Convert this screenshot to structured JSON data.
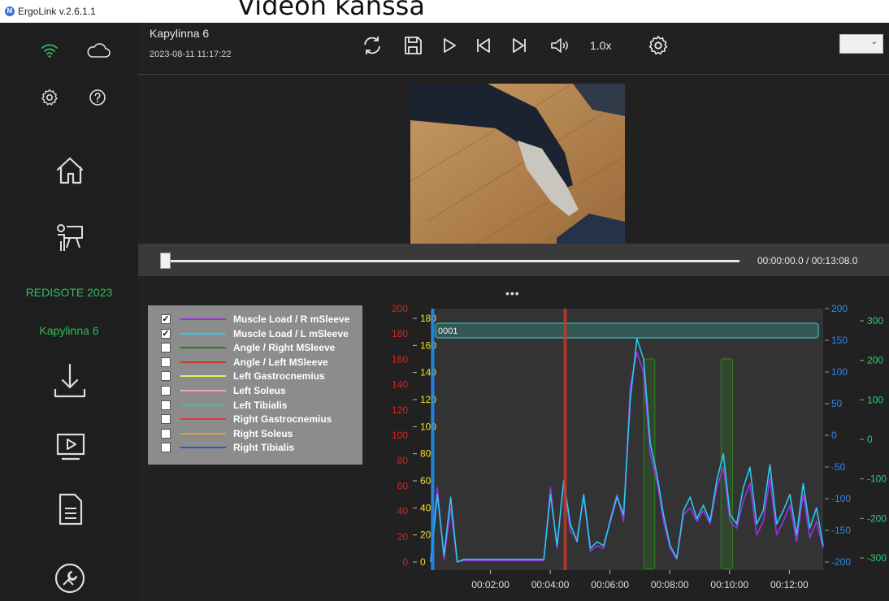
{
  "app": {
    "name": "ErgoLink v.2.6.1.1",
    "logo_letter": "M"
  },
  "overlay_title": "Videon kanssa",
  "sidebar": {
    "icons": [
      "wifi-icon",
      "cloud-icon",
      "gear-icon",
      "help-icon",
      "home-icon",
      "presentation-icon",
      "download-icon",
      "video-playback-icon",
      "report-icon",
      "tools-icon"
    ],
    "project": "REDISOTE 2023",
    "subject": "Kapylinna 6",
    "accent": "#2fbf5a"
  },
  "topbar": {
    "recording_title": "Kapylinna 6",
    "recording_date": "2023-08-11 11:17:22",
    "speed": "1.0x",
    "buttons": [
      "refresh-icon",
      "save-icon",
      "play-icon",
      "skip-back-icon",
      "skip-forward-icon",
      "volume-icon",
      "settings-icon"
    ]
  },
  "timeline": {
    "position": 0.0,
    "time_text": "00:00:00.0  /  00:13:08.0"
  },
  "more": "•••",
  "legend": [
    {
      "label": "Muscle Load / R mSleeve",
      "checked": true,
      "color": "#9b30e8"
    },
    {
      "label": "Muscle Load / L mSleeve",
      "checked": true,
      "color": "#29c8f0"
    },
    {
      "label": "Angle / Right MSleeve",
      "checked": false,
      "color": "#2e7d1e"
    },
    {
      "label": "Angle / Left MSleeve",
      "checked": false,
      "color": "#c0392b"
    },
    {
      "label": "Left Gastrocnemius",
      "checked": false,
      "color": "#e8f25a"
    },
    {
      "label": "Left Soleus",
      "checked": false,
      "color": "#f2a3c8"
    },
    {
      "label": "Left Tibialis",
      "checked": false,
      "color": "#2ec4b6"
    },
    {
      "label": "Right Gastrocnemius",
      "checked": false,
      "color": "#e8334a"
    },
    {
      "label": "Right Soleus",
      "checked": false,
      "color": "#e8a21e"
    },
    {
      "label": "Right Tibialis",
      "checked": false,
      "color": "#2557d6"
    }
  ],
  "chart_data": {
    "type": "line",
    "x_ticks": [
      "00:02:00",
      "00:04:00",
      "00:06:00",
      "00:08:00",
      "00:10:00",
      "00:12:00"
    ],
    "x_range_sec": [
      0,
      788
    ],
    "axes": [
      {
        "id": "red",
        "ticks": [
          200,
          180,
          160,
          140,
          120,
          100,
          80,
          60,
          40,
          20,
          0
        ],
        "color": "#e02020"
      },
      {
        "id": "yellow",
        "ticks": [
          180,
          160,
          140,
          120,
          100,
          80,
          60,
          40,
          20,
          0
        ],
        "color": "#f0e020"
      },
      {
        "id": "blue",
        "ticks": [
          200,
          150,
          100,
          50,
          0,
          -50,
          -100,
          -150,
          -200
        ],
        "color": "#2a8cf0"
      },
      {
        "id": "green",
        "ticks": [
          300,
          200,
          100,
          0,
          -100,
          -200,
          -300
        ],
        "color": "#2ecc71"
      }
    ],
    "annotation": "0001",
    "markers": [
      {
        "x_sec": 4,
        "color": "#1e90ff"
      },
      {
        "x_sec": 270,
        "color": "#c0392b"
      }
    ],
    "highlights": [
      {
        "from_sec": 428,
        "to_sec": 450,
        "color": "#2e7d1e"
      },
      {
        "from_sec": 583,
        "to_sec": 606,
        "color": "#2e7d1e"
      }
    ],
    "series": [
      {
        "name": "Muscle Load / R mSleeve",
        "color": "#9b30e8",
        "values": [
          0,
          55,
          2,
          40,
          0,
          1,
          1,
          1,
          1,
          1,
          1,
          1,
          1,
          1,
          1,
          1,
          1,
          1,
          55,
          10,
          60,
          22,
          18,
          48,
          8,
          12,
          10,
          32,
          50,
          30,
          130,
          155,
          140,
          80,
          60,
          30,
          10,
          2,
          35,
          40,
          30,
          38,
          28,
          55,
          70,
          30,
          25,
          45,
          58,
          20,
          30,
          62,
          20,
          30,
          42,
          15,
          50,
          18,
          30,
          10
        ]
      },
      {
        "name": "Muscle Load / L mSleeve",
        "color": "#29c8f0",
        "values": [
          0,
          50,
          5,
          48,
          0,
          2,
          2,
          2,
          2,
          2,
          2,
          2,
          2,
          2,
          2,
          2,
          2,
          2,
          50,
          12,
          60,
          28,
          15,
          50,
          10,
          15,
          12,
          30,
          48,
          35,
          120,
          165,
          150,
          88,
          65,
          35,
          12,
          3,
          38,
          48,
          32,
          42,
          30,
          60,
          80,
          35,
          28,
          55,
          70,
          28,
          38,
          72,
          28,
          38,
          50,
          20,
          58,
          25,
          40,
          12
        ]
      }
    ]
  }
}
